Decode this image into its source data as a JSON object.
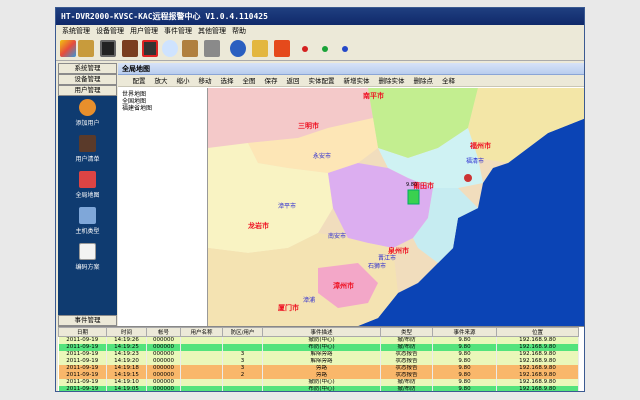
{
  "window": {
    "title": "HT-DVR2000-KVSC-KAC远程报警中心 V1.0.4.110425"
  },
  "menu": [
    "系统管理",
    "设备管理",
    "用户管理",
    "事件管理",
    "其他管理",
    "帮助"
  ],
  "sidebar": {
    "top_buttons": [
      "系统管理",
      "设备管理",
      "用户管理"
    ],
    "items": [
      "添加用户",
      "用户清单",
      "全局地图",
      "主机类型",
      "编码方案"
    ],
    "bottom_button": "事件管理"
  },
  "map_panel": {
    "title": "全局地图",
    "tools": [
      "配置",
      "放大",
      "缩小",
      "移动",
      "选择",
      "全图",
      "保存",
      "返回",
      "实体配置",
      "新增实体",
      "删除实体",
      "删除点",
      "全释"
    ],
    "tree": [
      "世界地图",
      "全国地图",
      "福建省地图"
    ],
    "labels": {
      "nanping": "南平市",
      "sanming": "三明市",
      "fuzhou": "福州市",
      "putian": "莆田市",
      "quanzhou": "泉州市",
      "zhangzhou": "漳州市",
      "xiamen": "厦门市",
      "longyan": "龙岩市",
      "yongan": "永安市",
      "fuqing": "福清市",
      "shishi": "石狮市",
      "zhangping": "漳平市",
      "nanan": "南安市",
      "jinjiang": "晋江市",
      "zhangpu": "漳浦",
      "marker_value": "9.80"
    }
  },
  "events": {
    "headers": [
      "日期",
      "时间",
      "帐号",
      "用户名称",
      "防区/用户",
      "事件描述",
      "类型",
      "事件来源",
      "位置"
    ],
    "rows": [
      {
        "date": "2011-09-19",
        "time": "14:19:26",
        "account": "000000",
        "user": "",
        "zone": "",
        "desc": "撤防(中心)",
        "type": "撤/布防",
        "source": "9.80",
        "pos": "192.168.9.80",
        "color": "#eaf7b9"
      },
      {
        "date": "2011-09-19",
        "time": "14:19:25",
        "account": "000000",
        "user": "",
        "zone": "",
        "desc": "布防(中心)",
        "type": "撤/布防",
        "source": "9.80",
        "pos": "192.168.9.80",
        "color": "#53e37c"
      },
      {
        "date": "2011-09-19",
        "time": "14:19:23",
        "account": "000000",
        "user": "",
        "zone": "3",
        "desc": "解除旁路",
        "type": "状态报告",
        "source": "9.80",
        "pos": "192.168.9.80",
        "color": "#eaf7b9"
      },
      {
        "date": "2011-09-19",
        "time": "14:19:20",
        "account": "000000",
        "user": "",
        "zone": "3",
        "desc": "解除旁路",
        "type": "状态报告",
        "source": "9.80",
        "pos": "192.168.9.80",
        "color": "#eaf7b9"
      },
      {
        "date": "2011-09-19",
        "time": "14:19:18",
        "account": "000000",
        "user": "",
        "zone": "3",
        "desc": "旁路",
        "type": "状态报告",
        "source": "9.80",
        "pos": "192.168.9.80",
        "color": "#f9b76a"
      },
      {
        "date": "2011-09-19",
        "time": "14:19:15",
        "account": "000000",
        "user": "",
        "zone": "2",
        "desc": "旁路",
        "type": "状态报告",
        "source": "9.80",
        "pos": "192.168.9.80",
        "color": "#f9b76a"
      },
      {
        "date": "2011-09-19",
        "time": "14:19:10",
        "account": "000000",
        "user": "",
        "zone": "",
        "desc": "撤防(中心)",
        "type": "撤/布防",
        "source": "9.80",
        "pos": "192.168.9.80",
        "color": "#eaf7b9"
      },
      {
        "date": "2011-09-19",
        "time": "14:19:05",
        "account": "000000",
        "user": "",
        "zone": "",
        "desc": "布防(中心)",
        "type": "撤/布防",
        "source": "9.80",
        "pos": "192.168.9.80",
        "color": "#53e37c"
      }
    ]
  },
  "colors": {
    "sidebar": "#0f3b70",
    "title": "#10296a"
  },
  "icons": [
    "logo-icon",
    "settings-icon",
    "monitor-icon",
    "book-icon",
    "user-icon",
    "search-icon",
    "building-icon",
    "bank-icon",
    "help-icon",
    "key-icon",
    "stop-icon"
  ]
}
